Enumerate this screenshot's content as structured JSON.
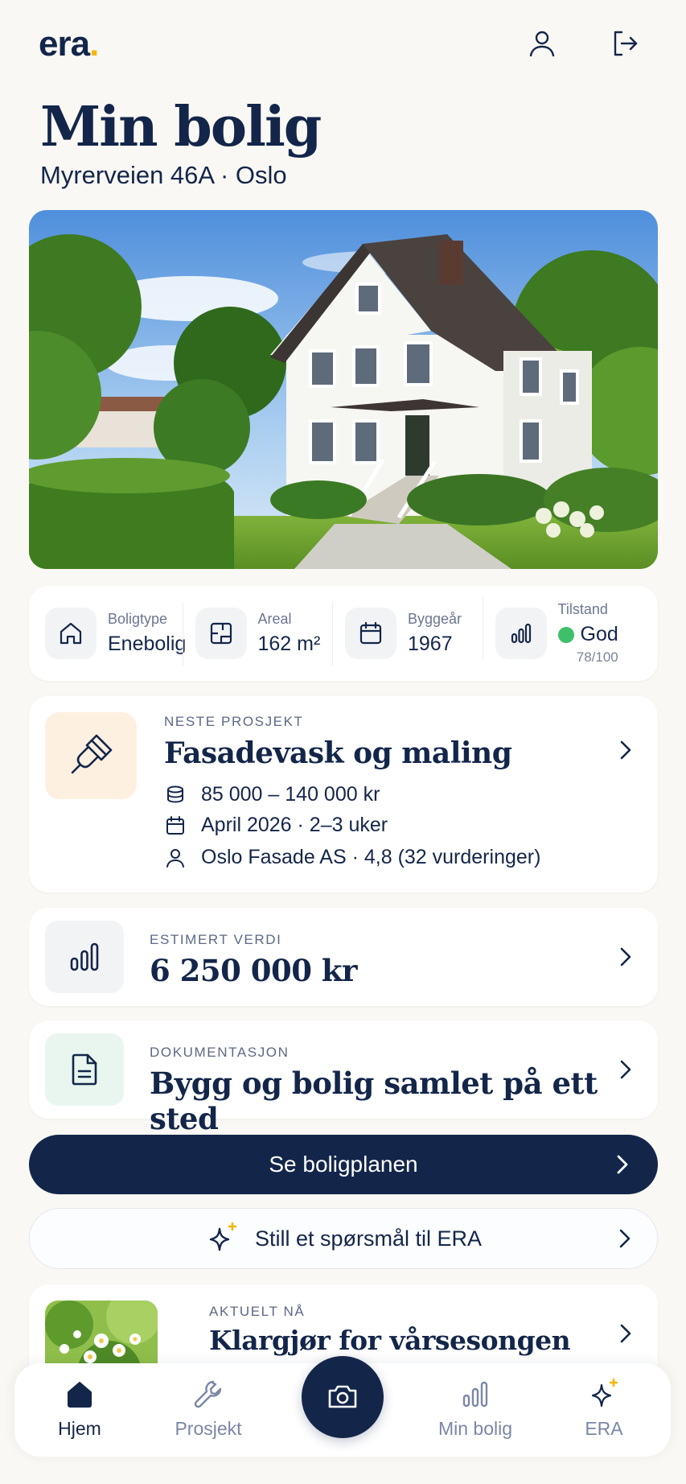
{
  "header": {
    "logo": "era",
    "logo_dot": ".",
    "title": "Min bolig",
    "address": "Myrerveien 46A · Oslo"
  },
  "hero": {
    "image": "white-wooden-house-photo"
  },
  "facts": [
    {
      "label": "Boligtype",
      "value": "Enebolig",
      "icon": "house-icon"
    },
    {
      "label": "Areal",
      "value": "162 m²",
      "icon": "floorplan-icon"
    },
    {
      "label": "Byggeår",
      "value": "1967",
      "icon": "calendar-icon"
    },
    {
      "label": "Tilstand",
      "value": "God",
      "score": "78/100",
      "icon": "bar-chart-icon",
      "status_color": "#3fbf6a"
    }
  ],
  "next_project": {
    "eyebrow": "NESTE PROSJEKT",
    "title": "Fasadevask og maling",
    "cost": "85 000 – 140 000 kr",
    "timing": "April 2026 · 2–3 uker",
    "contractor": "Oslo Fasade AS · 4,8 (32 vurderinger)",
    "icon": "paintbrush-icon"
  },
  "estimated_value": {
    "eyebrow": "ESTIMERT VERDI",
    "title": "6 250 000 kr",
    "icon": "bar-chart-icon"
  },
  "documentation": {
    "eyebrow": "DOKUMENTASJON",
    "title": "Bygg og bolig samlet på ett sted",
    "icon": "document-icon"
  },
  "plan_button": {
    "label": "Se boligplanen"
  },
  "ask_button": {
    "label": "Still et spørsmål til ERA"
  },
  "current": {
    "eyebrow": "AKTUELT NÅ",
    "title": "Klargjør for vårsesongen"
  },
  "nav": [
    {
      "label": "Hjem",
      "icon": "home-icon",
      "active": true
    },
    {
      "label": "Prosjekt",
      "icon": "wrench-icon",
      "active": false
    },
    {
      "label": "",
      "icon": "camera-icon",
      "active": false
    },
    {
      "label": "Min bolig",
      "icon": "bar-chart-icon",
      "active": false
    },
    {
      "label": "ERA",
      "icon": "sparkle-icon",
      "active": false
    }
  ],
  "colors": {
    "navy": "#13264a",
    "accent_yellow": "#f2b705",
    "status_green": "#3fbf6a",
    "background": "#faf8f4"
  }
}
